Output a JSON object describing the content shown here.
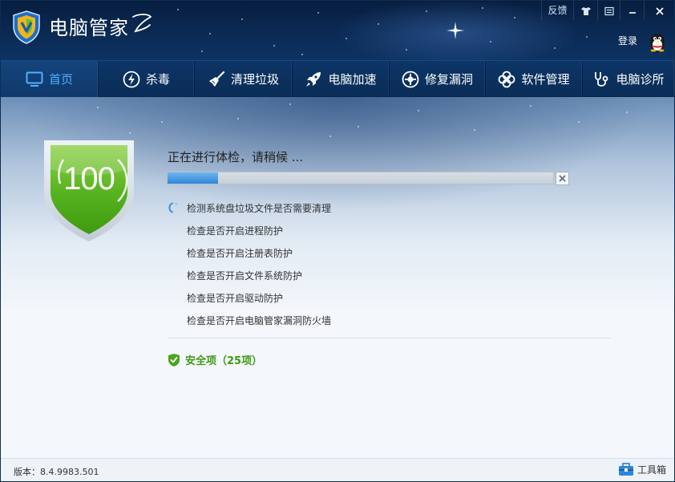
{
  "app": {
    "title": "电脑管家",
    "version_label": "版本：8.4.9983.501"
  },
  "top_controls": {
    "feedback": "反馈",
    "login": "登录"
  },
  "nav": [
    {
      "label": "首页",
      "icon": "monitor-icon",
      "active": true
    },
    {
      "label": "杀毒",
      "icon": "lightning-icon"
    },
    {
      "label": "清理垃圾",
      "icon": "broom-icon"
    },
    {
      "label": "电脑加速",
      "icon": "rocket-icon"
    },
    {
      "label": "修复漏洞",
      "icon": "repair-icon"
    },
    {
      "label": "软件管理",
      "icon": "clover-icon"
    },
    {
      "label": "电脑诊所",
      "icon": "stethoscope-icon"
    }
  ],
  "scan": {
    "score": "100",
    "status": "正在进行体检，请稍候 ...",
    "progress": 0.13,
    "items": [
      {
        "label": "检测系统盘垃圾文件是否需要清理",
        "in_progress": true
      },
      {
        "label": "检查是否开启进程防护"
      },
      {
        "label": "检查是否开启注册表防护"
      },
      {
        "label": "检查是否开启文件系统防护"
      },
      {
        "label": "检查是否开启驱动防护"
      },
      {
        "label": "检查是否开启电脑管家漏洞防火墙"
      }
    ],
    "safe_label": "安全项（25项）"
  },
  "footer": {
    "toolbox": "工具箱"
  },
  "colors": {
    "accent": "#4fb0ff",
    "safe_green": "#3c9b15",
    "progress_blue": "#2f86d8",
    "header_dark": "#0b2b55"
  }
}
